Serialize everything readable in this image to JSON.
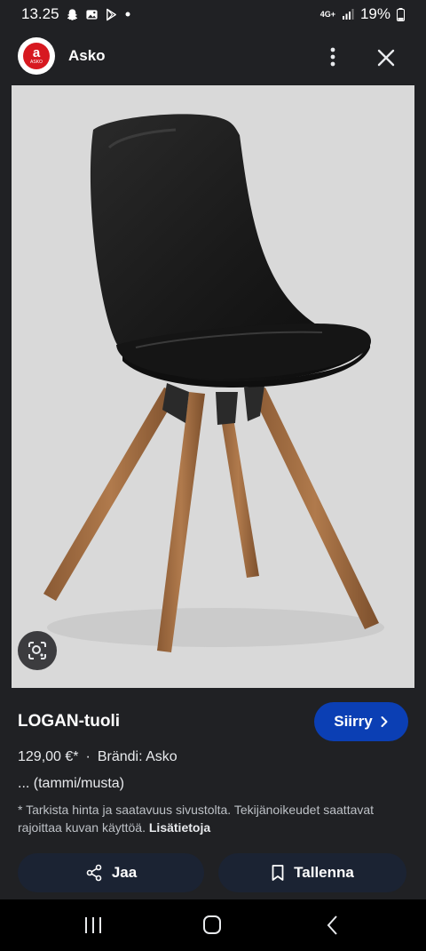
{
  "status": {
    "time": "13.25",
    "network": "4G+",
    "battery": "19%",
    "icons": [
      "snapchat-icon",
      "gallery-icon",
      "play-store-icon",
      "dot-icon"
    ]
  },
  "header": {
    "site_name": "Asko",
    "logo_letter": "a",
    "logo_text": "ASKO"
  },
  "product": {
    "title": "LOGAN-tuoli",
    "price": "129,00 €*",
    "separator": "·",
    "brand": "Brändi: Asko",
    "variant": "... (tammi/musta)",
    "disclaimer": "* Tarkista hinta ja saatavuus sivustolta. Tekijänoikeudet saattavat rajoittaa kuvan käyttöä.",
    "more_info": "Lisätietoja"
  },
  "buttons": {
    "goto": "Siirry",
    "share": "Jaa",
    "save": "Tallenna"
  },
  "colors": {
    "background": "#202124",
    "accent_button": "#0b3fb4",
    "secondary_button": "#1b2333",
    "image_background": "#d9d9d9",
    "brand_red": "#d71920"
  }
}
